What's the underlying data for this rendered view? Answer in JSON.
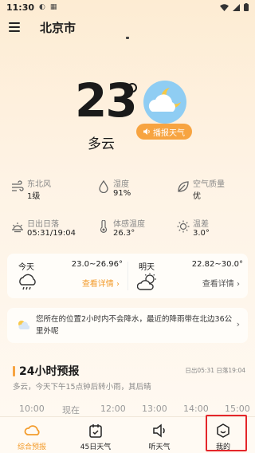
{
  "status_bar": {
    "time": "11:30"
  },
  "header": {
    "city": "北京市"
  },
  "current": {
    "temperature": "23",
    "condition": "多云",
    "broadcast_label": "播报天气"
  },
  "info": [
    {
      "label": "东北风",
      "value": "1级",
      "icon": "wind-icon"
    },
    {
      "label": "湿度",
      "value": "91%",
      "icon": "humidity-icon"
    },
    {
      "label": "空气质量",
      "value": "优",
      "icon": "leaf-icon"
    },
    {
      "label": "日出日落",
      "value": "05:31/19:04",
      "icon": "sunrise-icon"
    },
    {
      "label": "体感温度",
      "value": "26.3°",
      "icon": "thermometer-icon"
    },
    {
      "label": "温差",
      "value": "3.0°",
      "icon": "sun-icon"
    }
  ],
  "forecast": {
    "today": {
      "day": "今天",
      "range": "23.0~26.96°",
      "detail": "查看详情 ›",
      "icon": "rain-cloud-icon"
    },
    "tomorrow": {
      "day": "明天",
      "range": "22.82~30.0°",
      "detail": "查看详情 ›",
      "icon": "partly-cloudy-icon"
    }
  },
  "rain_notice": {
    "message": "您所在的位置2小时内不会降水，最近的降雨带在北边36公里外呢"
  },
  "hourly": {
    "title": "24小时预报",
    "sun_times": "日出05:31 日落19:04",
    "description": "多云，今天下午15点钟后转小雨，其后晴",
    "hours": [
      "10:00",
      "现在",
      "12:00",
      "13:00",
      "14:00",
      "15:00"
    ]
  },
  "bottom_nav": [
    {
      "label": "综合预报",
      "icon": "cloud-icon",
      "active": true
    },
    {
      "label": "45日天气",
      "icon": "calendar-icon",
      "active": false
    },
    {
      "label": "听天气",
      "icon": "speaker-icon",
      "active": false
    },
    {
      "label": "我的",
      "icon": "profile-icon",
      "active": false
    }
  ],
  "colors": {
    "accent": "#f7a441",
    "active_nav": "#f39c2c",
    "highlight": "#e4262a"
  }
}
